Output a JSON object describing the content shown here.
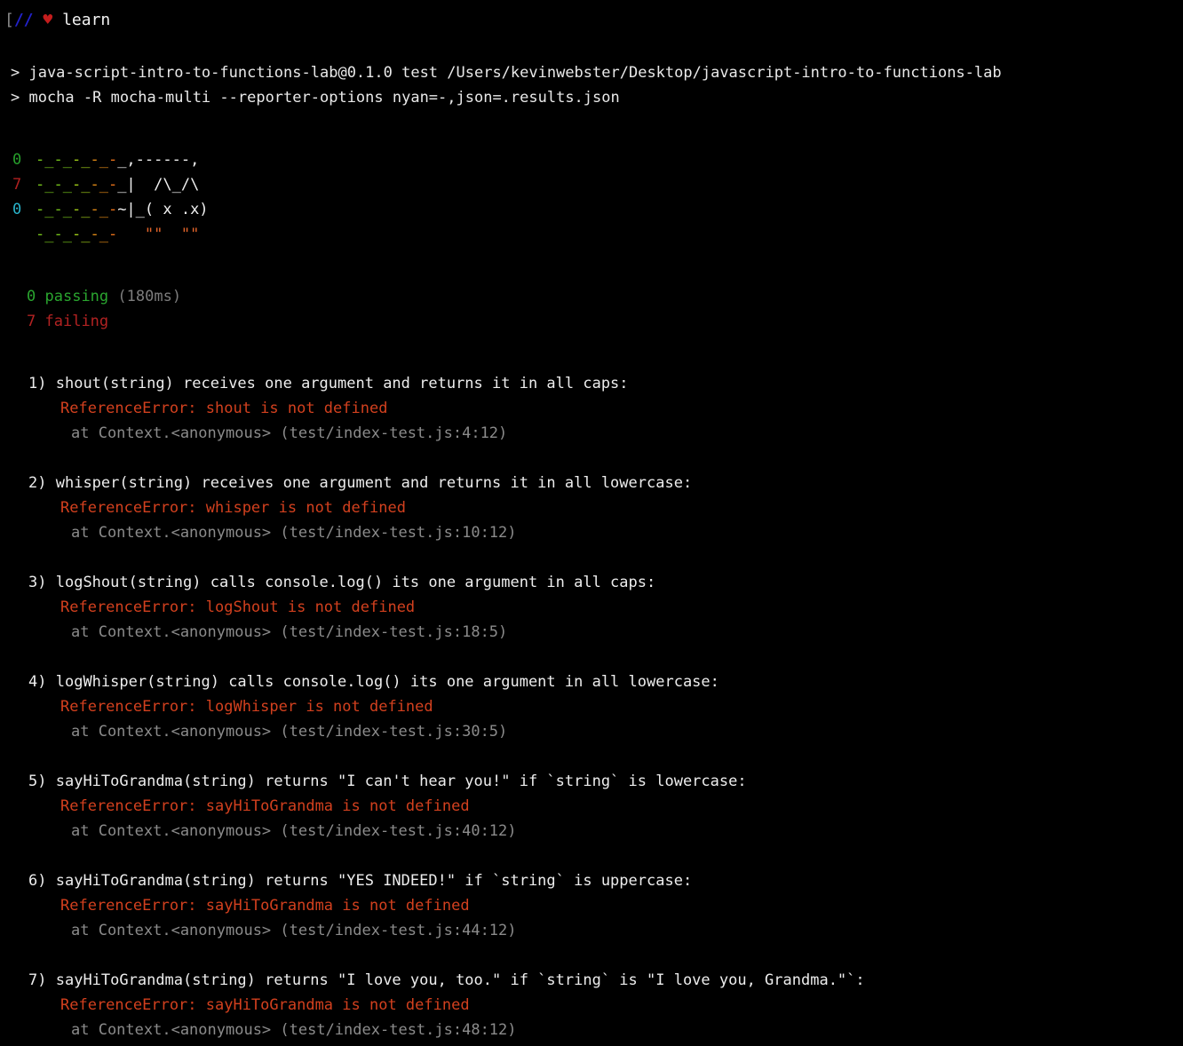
{
  "window": {
    "background": "#000000",
    "foreground": "#e6e6e6"
  },
  "header": {
    "bracket": "[",
    "slashes": "//",
    "heart": "♥",
    "brand": "learn"
  },
  "npm_output": {
    "line1": "> java-script-intro-to-functions-lab@0.1.0 test /Users/kevinwebster/Desktop/javascript-intro-to-functions-lab",
    "line2": "> mocha -R mocha-multi --reporter-options nyan=-,json=.results.json"
  },
  "nyan": {
    "counts": {
      "passing": "0",
      "failing": "7",
      "pending": "0"
    },
    "rows": [
      {
        "trail": "-_-_-_-_-_",
        "body": "_,------,"
      },
      {
        "trail": "-_-_-_-_-_",
        "body": "_|  /\\_/\\"
      },
      {
        "trail": "-_-_-_-_-_",
        "body": "~|_( x .x)"
      },
      {
        "trail": "-_-_-_-_-_",
        "body": "  \"\"  \"\""
      }
    ]
  },
  "summary": {
    "passing_count": "0",
    "passing_label": "passing",
    "duration": "(180ms)",
    "failing_count": "7",
    "failing_label": "failing"
  },
  "failures": [
    {
      "index": "1)",
      "title": "shout(string) receives one argument and returns it in all caps:",
      "error": "ReferenceError: shout is not defined",
      "stack": "at Context.<anonymous> (test/index-test.js:4:12)"
    },
    {
      "index": "2)",
      "title": "whisper(string) receives one argument and returns it in all lowercase:",
      "error": "ReferenceError: whisper is not defined",
      "stack": "at Context.<anonymous> (test/index-test.js:10:12)"
    },
    {
      "index": "3)",
      "title": "logShout(string) calls console.log() its one argument in all caps:",
      "error": "ReferenceError: logShout is not defined",
      "stack": "at Context.<anonymous> (test/index-test.js:18:5)"
    },
    {
      "index": "4)",
      "title": "logWhisper(string) calls console.log() its one argument in all lowercase:",
      "error": "ReferenceError: logWhisper is not defined",
      "stack": "at Context.<anonymous> (test/index-test.js:30:5)"
    },
    {
      "index": "5)",
      "title": "sayHiToGrandma(string) returns \"I can't hear you!\" if `string` is lowercase:",
      "error": "ReferenceError: sayHiToGrandma is not defined",
      "stack": "at Context.<anonymous> (test/index-test.js:40:12)"
    },
    {
      "index": "6)",
      "title": "sayHiToGrandma(string) returns \"YES INDEED!\" if `string` is uppercase:",
      "error": "ReferenceError: sayHiToGrandma is not defined",
      "stack": "at Context.<anonymous> (test/index-test.js:44:12)"
    },
    {
      "index": "7)",
      "title": "sayHiToGrandma(string) returns \"I love you, too.\" if `string` is \"I love you, Grandma.\"`:",
      "error": "ReferenceError: sayHiToGrandma is not defined",
      "stack": "at Context.<anonymous> (test/index-test.js:48:12)"
    }
  ],
  "colors": {
    "pass_green": "#2aa52f",
    "fail_red": "#b22222",
    "error_orange_red": "#d2401e",
    "stack_gray": "#8b8b8b",
    "pending_cyan": "#29b5cc",
    "logo_blue": "#2222cc",
    "heart_red": "#c41d1d"
  }
}
